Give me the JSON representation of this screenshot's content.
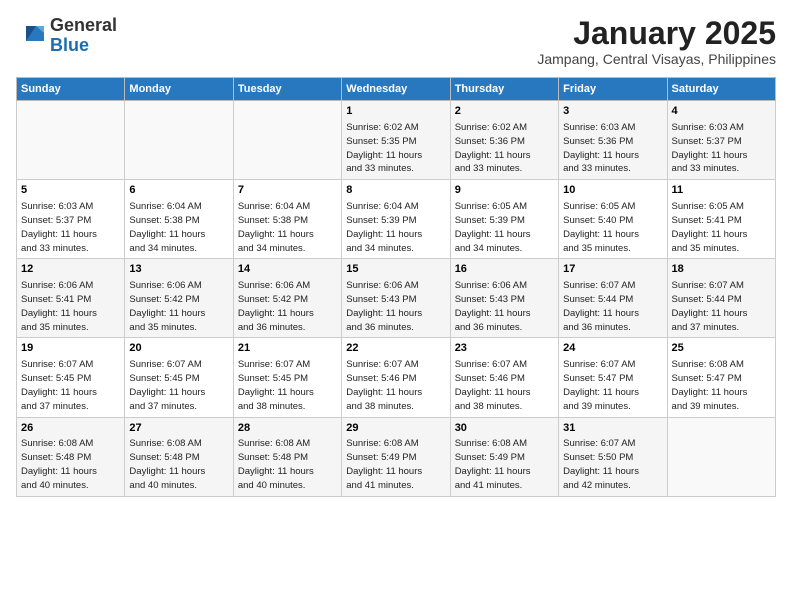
{
  "logo": {
    "general": "General",
    "blue": "Blue"
  },
  "title": "January 2025",
  "location": "Jampang, Central Visayas, Philippines",
  "weekdays": [
    "Sunday",
    "Monday",
    "Tuesday",
    "Wednesday",
    "Thursday",
    "Friday",
    "Saturday"
  ],
  "weeks": [
    [
      {
        "day": "",
        "info": ""
      },
      {
        "day": "",
        "info": ""
      },
      {
        "day": "",
        "info": ""
      },
      {
        "day": "1",
        "info": "Sunrise: 6:02 AM\nSunset: 5:35 PM\nDaylight: 11 hours\nand 33 minutes."
      },
      {
        "day": "2",
        "info": "Sunrise: 6:02 AM\nSunset: 5:36 PM\nDaylight: 11 hours\nand 33 minutes."
      },
      {
        "day": "3",
        "info": "Sunrise: 6:03 AM\nSunset: 5:36 PM\nDaylight: 11 hours\nand 33 minutes."
      },
      {
        "day": "4",
        "info": "Sunrise: 6:03 AM\nSunset: 5:37 PM\nDaylight: 11 hours\nand 33 minutes."
      }
    ],
    [
      {
        "day": "5",
        "info": "Sunrise: 6:03 AM\nSunset: 5:37 PM\nDaylight: 11 hours\nand 33 minutes."
      },
      {
        "day": "6",
        "info": "Sunrise: 6:04 AM\nSunset: 5:38 PM\nDaylight: 11 hours\nand 34 minutes."
      },
      {
        "day": "7",
        "info": "Sunrise: 6:04 AM\nSunset: 5:38 PM\nDaylight: 11 hours\nand 34 minutes."
      },
      {
        "day": "8",
        "info": "Sunrise: 6:04 AM\nSunset: 5:39 PM\nDaylight: 11 hours\nand 34 minutes."
      },
      {
        "day": "9",
        "info": "Sunrise: 6:05 AM\nSunset: 5:39 PM\nDaylight: 11 hours\nand 34 minutes."
      },
      {
        "day": "10",
        "info": "Sunrise: 6:05 AM\nSunset: 5:40 PM\nDaylight: 11 hours\nand 35 minutes."
      },
      {
        "day": "11",
        "info": "Sunrise: 6:05 AM\nSunset: 5:41 PM\nDaylight: 11 hours\nand 35 minutes."
      }
    ],
    [
      {
        "day": "12",
        "info": "Sunrise: 6:06 AM\nSunset: 5:41 PM\nDaylight: 11 hours\nand 35 minutes."
      },
      {
        "day": "13",
        "info": "Sunrise: 6:06 AM\nSunset: 5:42 PM\nDaylight: 11 hours\nand 35 minutes."
      },
      {
        "day": "14",
        "info": "Sunrise: 6:06 AM\nSunset: 5:42 PM\nDaylight: 11 hours\nand 36 minutes."
      },
      {
        "day": "15",
        "info": "Sunrise: 6:06 AM\nSunset: 5:43 PM\nDaylight: 11 hours\nand 36 minutes."
      },
      {
        "day": "16",
        "info": "Sunrise: 6:06 AM\nSunset: 5:43 PM\nDaylight: 11 hours\nand 36 minutes."
      },
      {
        "day": "17",
        "info": "Sunrise: 6:07 AM\nSunset: 5:44 PM\nDaylight: 11 hours\nand 36 minutes."
      },
      {
        "day": "18",
        "info": "Sunrise: 6:07 AM\nSunset: 5:44 PM\nDaylight: 11 hours\nand 37 minutes."
      }
    ],
    [
      {
        "day": "19",
        "info": "Sunrise: 6:07 AM\nSunset: 5:45 PM\nDaylight: 11 hours\nand 37 minutes."
      },
      {
        "day": "20",
        "info": "Sunrise: 6:07 AM\nSunset: 5:45 PM\nDaylight: 11 hours\nand 37 minutes."
      },
      {
        "day": "21",
        "info": "Sunrise: 6:07 AM\nSunset: 5:45 PM\nDaylight: 11 hours\nand 38 minutes."
      },
      {
        "day": "22",
        "info": "Sunrise: 6:07 AM\nSunset: 5:46 PM\nDaylight: 11 hours\nand 38 minutes."
      },
      {
        "day": "23",
        "info": "Sunrise: 6:07 AM\nSunset: 5:46 PM\nDaylight: 11 hours\nand 38 minutes."
      },
      {
        "day": "24",
        "info": "Sunrise: 6:07 AM\nSunset: 5:47 PM\nDaylight: 11 hours\nand 39 minutes."
      },
      {
        "day": "25",
        "info": "Sunrise: 6:08 AM\nSunset: 5:47 PM\nDaylight: 11 hours\nand 39 minutes."
      }
    ],
    [
      {
        "day": "26",
        "info": "Sunrise: 6:08 AM\nSunset: 5:48 PM\nDaylight: 11 hours\nand 40 minutes."
      },
      {
        "day": "27",
        "info": "Sunrise: 6:08 AM\nSunset: 5:48 PM\nDaylight: 11 hours\nand 40 minutes."
      },
      {
        "day": "28",
        "info": "Sunrise: 6:08 AM\nSunset: 5:48 PM\nDaylight: 11 hours\nand 40 minutes."
      },
      {
        "day": "29",
        "info": "Sunrise: 6:08 AM\nSunset: 5:49 PM\nDaylight: 11 hours\nand 41 minutes."
      },
      {
        "day": "30",
        "info": "Sunrise: 6:08 AM\nSunset: 5:49 PM\nDaylight: 11 hours\nand 41 minutes."
      },
      {
        "day": "31",
        "info": "Sunrise: 6:07 AM\nSunset: 5:50 PM\nDaylight: 11 hours\nand 42 minutes."
      },
      {
        "day": "",
        "info": ""
      }
    ]
  ]
}
